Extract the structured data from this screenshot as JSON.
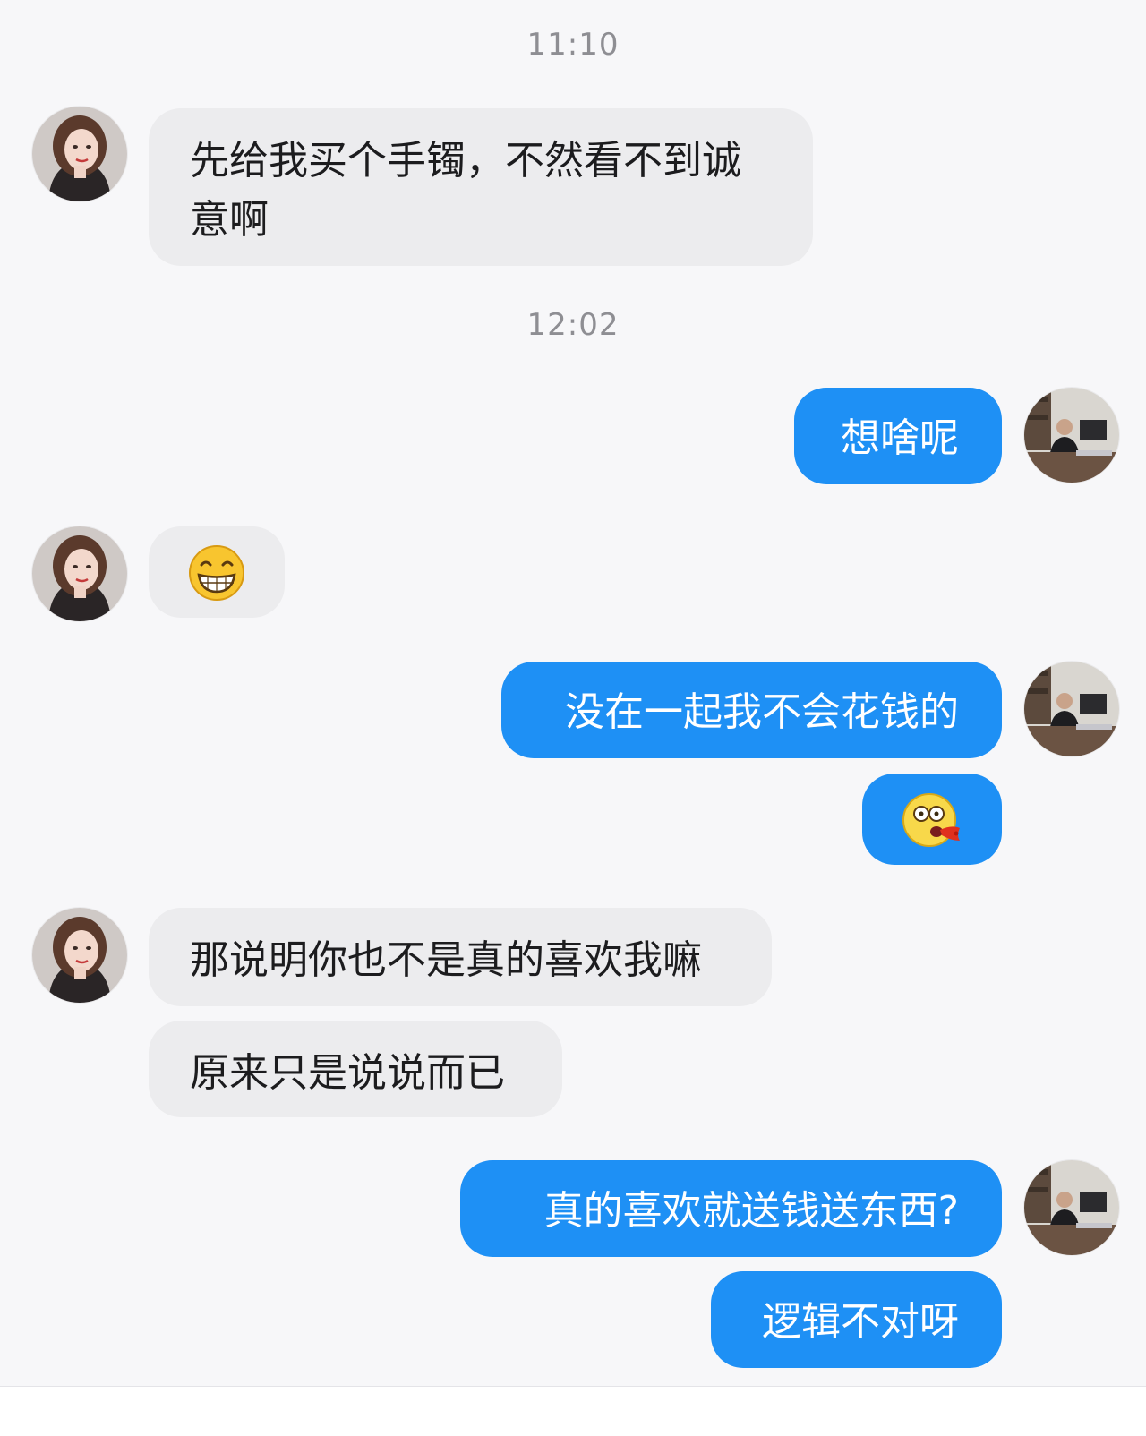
{
  "timestamps": [
    "11:10",
    "12:02"
  ],
  "contact": {
    "avatar_icon": "woman-avatar-icon"
  },
  "me": {
    "avatar_icon": "man-office-avatar-icon"
  },
  "messages": [
    {
      "from": "contact",
      "text": "先给我买个手镯，不然看不到诚意啊"
    },
    {
      "from": "me",
      "text": "想啥呢"
    },
    {
      "from": "contact",
      "emoji": "grinning-face-icon"
    },
    {
      "from": "me",
      "text": "没在一起我不会花钱的"
    },
    {
      "from": "me",
      "emoji": "shocked-spitting-blood-face-icon"
    },
    {
      "from": "contact",
      "text": "那说明你也不是真的喜欢我嘛"
    },
    {
      "from": "contact",
      "text": "原来只是说说而已"
    },
    {
      "from": "me",
      "text": "真的喜欢就送钱送东西?"
    },
    {
      "from": "me",
      "text": "逻辑不对呀"
    }
  ],
  "colors": {
    "incoming_bubble": "#ececee",
    "outgoing_bubble": "#1e90f5",
    "background": "#f7f7f9"
  }
}
